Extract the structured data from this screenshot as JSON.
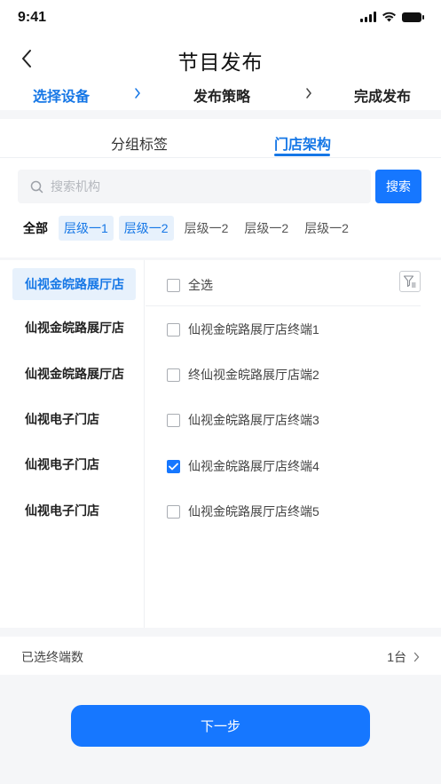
{
  "status_bar": {
    "time": "9:41",
    "icons": [
      "signal-icon",
      "wifi-icon",
      "battery-icon"
    ]
  },
  "nav": {
    "title": "节目发布",
    "back_icon": "chevron-left-icon"
  },
  "steps": [
    {
      "label": "选择设备",
      "active": true
    },
    {
      "label": "发布策略",
      "active": false
    },
    {
      "label": "完成发布",
      "active": false
    }
  ],
  "tabs": [
    {
      "label": "分组标签",
      "active": false
    },
    {
      "label": "门店架构",
      "active": true
    }
  ],
  "search": {
    "placeholder": "搜索机构",
    "value": "",
    "button_label": "搜索"
  },
  "levels": [
    {
      "label": "全部",
      "selected": false
    },
    {
      "label": "层级一1",
      "selected": true
    },
    {
      "label": "层级一2",
      "selected": true
    },
    {
      "label": "层级一2",
      "selected": false
    },
    {
      "label": "层级一2",
      "selected": false
    },
    {
      "label": "层级一2",
      "selected": false
    }
  ],
  "stores": [
    {
      "name": "仙视金皖路展厅店",
      "active": true
    },
    {
      "name": "仙视金皖路展厅店",
      "active": false
    },
    {
      "name": "仙视金皖路展厅店",
      "active": false
    },
    {
      "name": "仙视电子门店",
      "active": false
    },
    {
      "name": "仙视电子门店",
      "active": false
    },
    {
      "name": "仙视电子门店",
      "active": false
    }
  ],
  "select_all_label": "全选",
  "terminals": [
    {
      "label": "仙视金皖路展厅店终端1",
      "checked": false
    },
    {
      "label": "终仙视金皖路展厅店端2",
      "checked": false
    },
    {
      "label": "仙视金皖路展厅店终端3",
      "checked": false
    },
    {
      "label": "仙视金皖路展厅店终端4",
      "checked": true
    },
    {
      "label": "仙视金皖路展厅店终端5",
      "checked": false
    }
  ],
  "summary": {
    "label": "已选终端数",
    "value": "1台"
  },
  "next_button": "下一步",
  "colors": {
    "accent": "#1677ff",
    "accent_text": "#1677e6",
    "selected_bg": "#e7f1fc",
    "page_bg": "#f5f6f8"
  }
}
